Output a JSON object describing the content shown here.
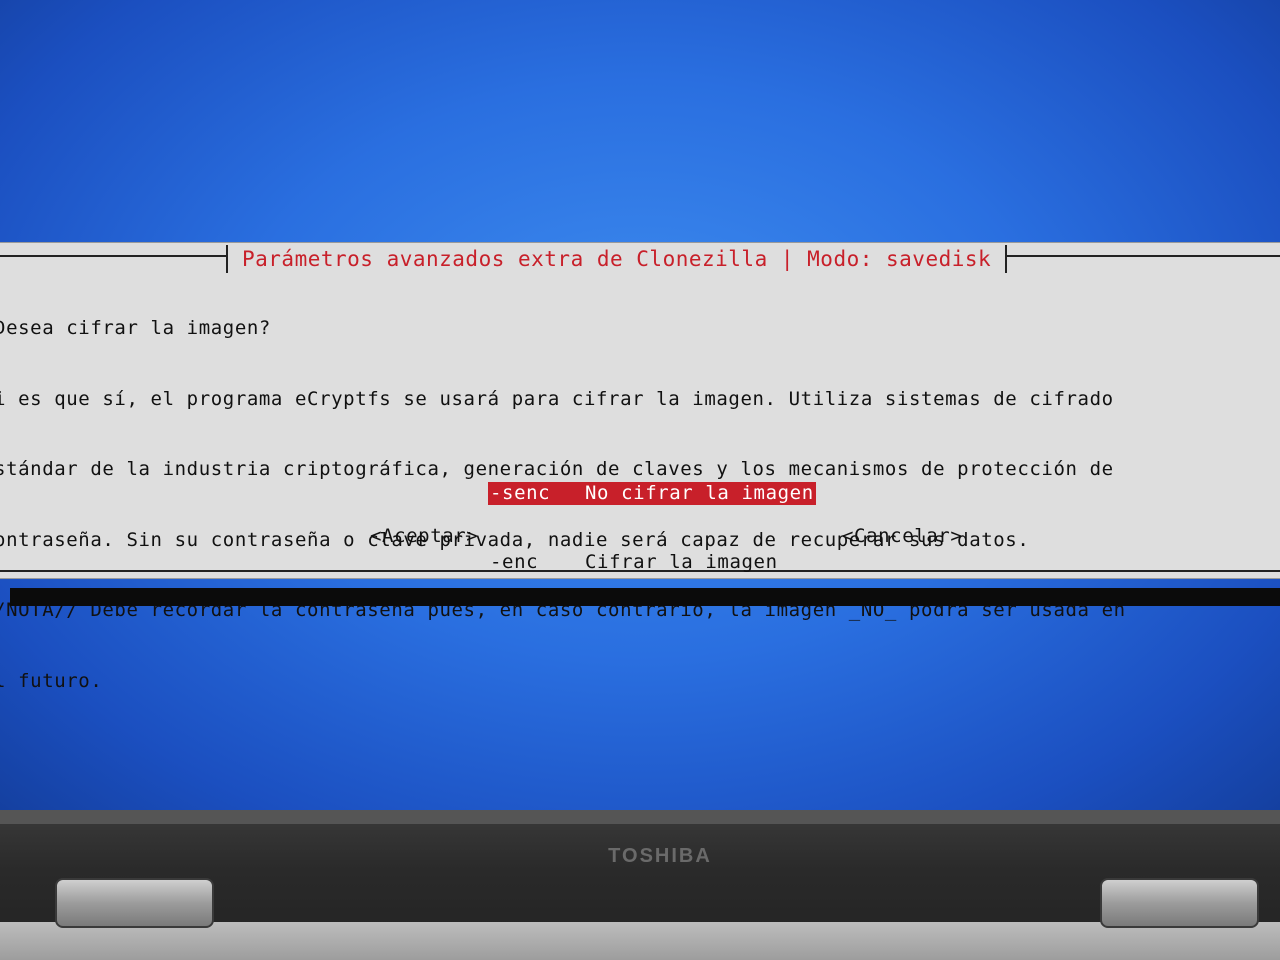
{
  "dialog": {
    "title": "Parámetros avanzados extra de Clonezilla | Modo: savedisk",
    "body_lines": [
      "¿Desea cifrar la imagen?",
      "Si es que sí, el programa eCryptfs se usará para cifrar la imagen. Utiliza sistemas de cifrado",
      "estándar de la industria criptográfica, generación de claves y los mecanismos de protección de",
      "contraseña. Sin su contraseña o clave privada, nadie será capaz de recuperar sus datos.",
      "//NOTA// Debe recordar la contraseña pues, en caso contrario, la imagen _NO_ podrá ser usada en",
      "el futuro."
    ],
    "options": [
      {
        "tag": "-senc",
        "label": "No cifrar la imagen",
        "selected": true
      },
      {
        "tag": "-enc",
        "label": "Cifrar la imagen",
        "selected": false
      }
    ],
    "accept_label": "<Aceptar>",
    "cancel_label": "<Cancelar>"
  },
  "device": {
    "brand": "TOSHIBA"
  },
  "colors": {
    "accent": "#c8202a",
    "dialog_bg": "#dedede",
    "screen_bg": "#2a6fe0"
  }
}
